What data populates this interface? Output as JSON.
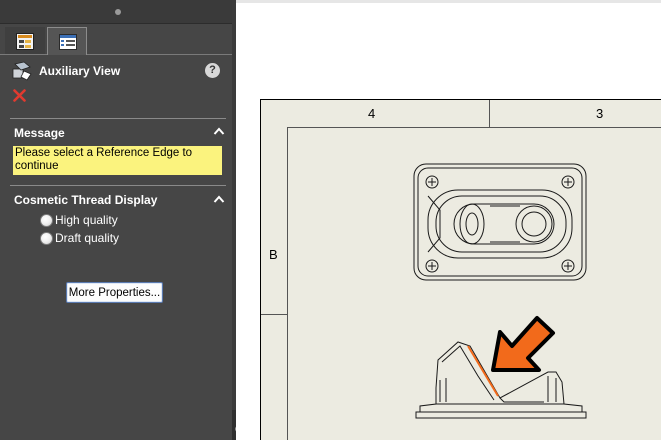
{
  "property_manager": {
    "title": "Auxiliary View",
    "help_label": "?",
    "tabs": [
      {
        "name": "FeatureManager",
        "icon": "feature-tree-icon"
      },
      {
        "name": "PropertyManager",
        "icon": "property-manager-icon"
      }
    ],
    "message": {
      "title": "Message",
      "text": "Please select a Reference Edge to continue"
    },
    "cosmetic_thread": {
      "title": "Cosmetic Thread Display",
      "options": [
        "High quality",
        "Draft quality"
      ],
      "selected": null
    },
    "more_properties_label": "More Properties..."
  },
  "drawing_sheet": {
    "zone_columns": [
      "4",
      "3"
    ],
    "zone_rows": [
      "B"
    ],
    "highlight_color": "#f26a1b",
    "callout": "orange-arrow-pointing-at-edge"
  }
}
